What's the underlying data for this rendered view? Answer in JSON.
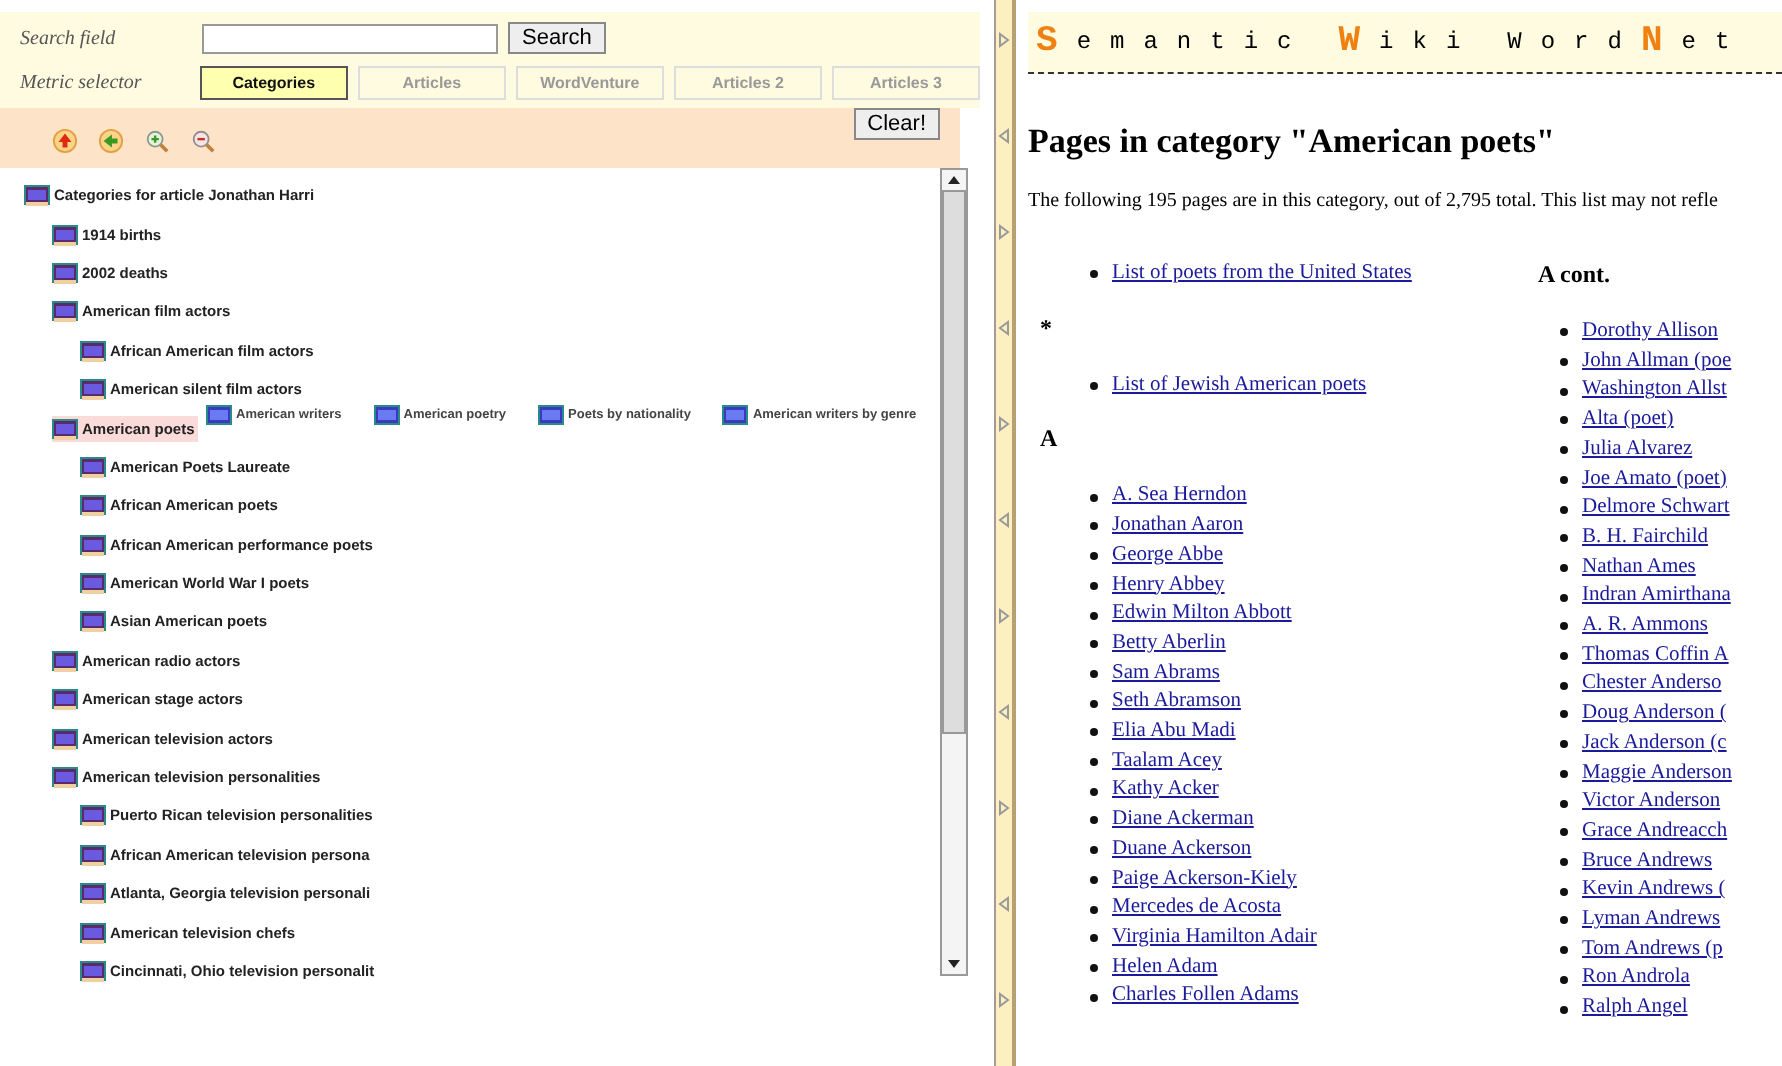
{
  "search": {
    "label": "Search field",
    "button": "Search"
  },
  "metric": {
    "label": "Metric selector",
    "tabs": [
      {
        "label": "Categories",
        "selected": true
      },
      {
        "label": "Articles",
        "selected": false
      },
      {
        "label": "WordVenture",
        "selected": false
      },
      {
        "label": "Articles 2",
        "selected": false
      },
      {
        "label": "Articles 3",
        "selected": false
      }
    ]
  },
  "toolbar": {
    "clear_button": "Clear!"
  },
  "tree": {
    "label": "Categories for article Jonathan Harri",
    "selected": false,
    "children": [
      {
        "label": "1914 births",
        "selected": false
      },
      {
        "label": "2002 deaths",
        "selected": false
      },
      {
        "label": "American film actors",
        "selected": false,
        "children": [
          {
            "label": "African American film actors",
            "selected": false
          },
          {
            "label": "American silent film actors",
            "selected": false
          }
        ]
      },
      {
        "label": "American poets",
        "selected": true,
        "related": [
          "American writers",
          "American poetry",
          "Poets by nationality",
          "American writers by genre"
        ],
        "children": [
          {
            "label": "American Poets Laureate",
            "selected": false
          },
          {
            "label": "African American poets",
            "selected": false
          },
          {
            "label": "African American performance poets",
            "selected": false
          },
          {
            "label": "American World War I poets",
            "selected": false
          },
          {
            "label": "Asian American poets",
            "selected": false
          }
        ]
      },
      {
        "label": "American radio actors",
        "selected": false
      },
      {
        "label": "American stage actors",
        "selected": false
      },
      {
        "label": "American television actors",
        "selected": false
      },
      {
        "label": "American television personalities",
        "selected": false,
        "children": [
          {
            "label": "Puerto Rican television personalities",
            "selected": false
          },
          {
            "label": "African American television persona",
            "selected": false
          },
          {
            "label": "Atlanta, Georgia television personali",
            "selected": false
          },
          {
            "label": "American television chefs",
            "selected": false
          },
          {
            "label": "Cincinnati, Ohio television personalit",
            "selected": false
          }
        ]
      }
    ]
  },
  "wiki": {
    "logo": [
      {
        "text": "S",
        "accent": true
      },
      {
        "text": "emantic",
        "accent": false
      },
      {
        "text": "W",
        "accent": true
      },
      {
        "text": "iki",
        "accent": false
      },
      {
        "text": "Word",
        "accent": false
      },
      {
        "text": "N",
        "accent": true
      },
      {
        "text": "et",
        "accent": false
      }
    ],
    "title": "Pages in category \"American poets\"",
    "intro": "The following 195 pages are in this category, out of 2,795 total. This list may not refle",
    "columns": [
      {
        "sections": [
          {
            "items": [
              "List of poets from the United States"
            ]
          },
          {
            "heading": "*",
            "items": [
              "List of Jewish American poets"
            ]
          },
          {
            "heading": "A",
            "items": [
              "A. Sea Herndon",
              "Jonathan Aaron",
              "George Abbe",
              "Henry Abbey",
              "Edwin Milton Abbott",
              "Betty Aberlin",
              "Sam Abrams",
              "Seth Abramson",
              "Elia Abu Madi",
              "Taalam Acey",
              "Kathy Acker",
              "Diane Ackerman",
              "Duane Ackerson",
              "Paige Ackerson-Kiely",
              "Mercedes de Acosta",
              "Virginia Hamilton Adair",
              "Helen Adam",
              "Charles Follen Adams"
            ]
          }
        ]
      },
      {
        "sections": [
          {
            "heading": "A cont.",
            "items": [
              "Dorothy Allison",
              "John Allman (poe",
              "Washington Allst",
              "Alta (poet)",
              "Julia Alvarez",
              "Joe Amato (poet)",
              "Delmore Schwart",
              "B. H. Fairchild",
              "Nathan Ames",
              "Indran Amirthana",
              "A. R. Ammons",
              "Thomas Coffin A",
              "Chester Anderso",
              "Doug Anderson (",
              "Jack Anderson (c",
              "Maggie Anderson",
              "Victor Anderson",
              "Grace Andreacch",
              "Bruce Andrews",
              "Kevin Andrews (",
              "Lyman Andrews",
              "Tom Andrews (p",
              "Ron Androla",
              "Ralph Angel"
            ]
          }
        ]
      }
    ]
  }
}
